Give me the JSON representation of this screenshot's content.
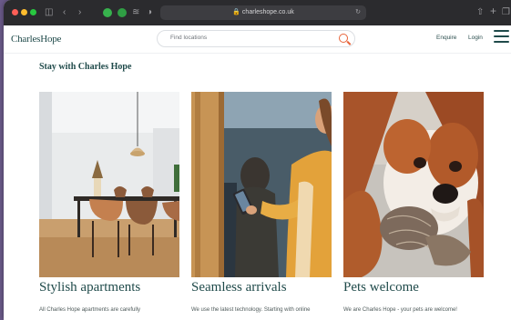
{
  "browser": {
    "url": "charleshope.co.uk",
    "colors": {
      "chrome": "#2b2b2e",
      "urlbar": "#3d3d41"
    }
  },
  "site": {
    "logo": "CharlesHope",
    "search_placeholder": "Find locations",
    "nav": {
      "enquire": "Enquire",
      "login": "Login"
    },
    "colors": {
      "brand": "#1f4a4a",
      "accent": "#e8643a"
    }
  },
  "main": {
    "section_title": "Stay with Charles Hope",
    "cards": [
      {
        "title": "Stylish apartments",
        "desc": "All Charles Hope apartments are carefully",
        "image": "dining-room-photo"
      },
      {
        "title": "Seamless arrivals",
        "desc": "We use the latest technology. Starting with online",
        "image": "phone-door-photo"
      },
      {
        "title": "Pets welcome",
        "desc": "We are Charles Hope - your pets are welcome!",
        "image": "dog-photo"
      }
    ]
  }
}
